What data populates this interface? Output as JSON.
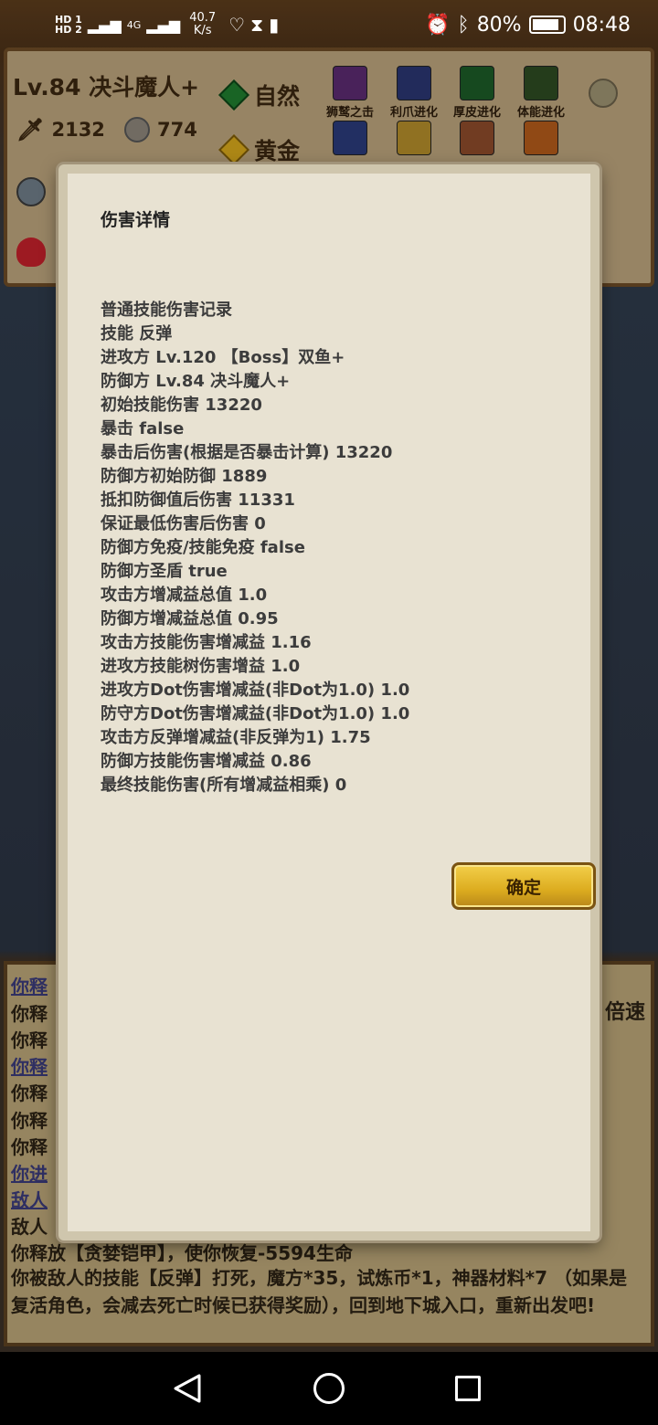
{
  "status_bar": {
    "sim1": "HD 1",
    "sim2": "HD 2",
    "net": "4G",
    "speed_value": "40.7",
    "speed_unit": "K/s",
    "battery": "80%",
    "time": "08:48"
  },
  "game": {
    "player_title": "Lv.84 决斗魔人+",
    "attack_value": "2132",
    "coin_value": "774",
    "element_1": "自然",
    "element_2": "黄金",
    "skills": [
      "狮鹫之击",
      "利爪进化",
      "厚皮进化",
      "体能进化"
    ],
    "speed_label": "倍速"
  },
  "log": {
    "lines": [
      "你释",
      "你释",
      "你释",
      "你释",
      "你释",
      "你释",
      "你释",
      "你进",
      "敌人",
      "敌人"
    ],
    "heal_line": "你释放【贪婪铠甲】，使你恢复-5594生命",
    "death_line": "你被敌人的技能【反弹】打死，魔方*35，试炼币*1，神器材料*7 （如果是复活角色，会减去死亡时候已获得奖励），回到地下城入口，重新出发吧!"
  },
  "dialog": {
    "title": "伤害详情",
    "details": [
      "普通技能伤害记录",
      "技能 反弹",
      "进攻方 Lv.120 【Boss】双鱼+",
      "防御方 Lv.84 决斗魔人+",
      "初始技能伤害 13220",
      "暴击 false",
      "暴击后伤害(根据是否暴击计算) 13220",
      "防御方初始防御 1889",
      "抵扣防御值后伤害 11331",
      "保证最低伤害后伤害 0",
      "防御方免疫/技能免疫 false",
      "防御方圣盾 true",
      "攻击方增减益总值 1.0",
      "防御方增减益总值 0.95",
      "攻击方技能伤害增减益 1.16",
      "进攻方技能树伤害增益 1.0",
      "进攻方Dot伤害增减益(非Dot为1.0) 1.0",
      "防守方Dot伤害增减益(非Dot为1.0) 1.0",
      "攻击方反弹增减益(非反弹为1) 1.75",
      "防御方技能伤害增减益 0.86",
      "最终技能伤害(所有增减益相乘) 0"
    ],
    "confirm_label": "确定"
  },
  "colors": {
    "dialog_bg": "#e8e2d2",
    "button_gold": "#dcac1f",
    "panel_brown": "#b9a27a"
  }
}
